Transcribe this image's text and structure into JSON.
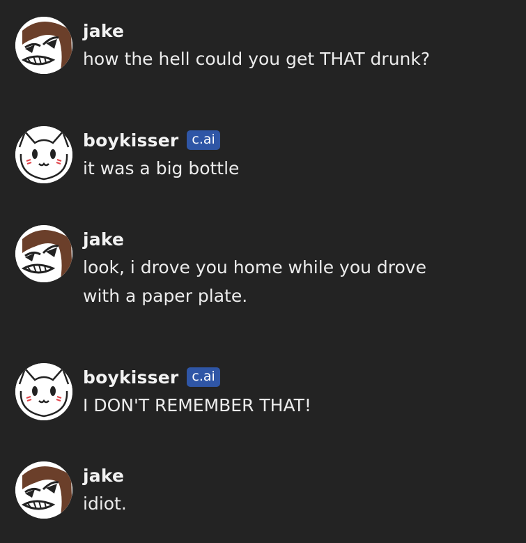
{
  "messages": [
    {
      "author": "jake",
      "avatar_icon": "jake-avatar-icon",
      "badge": "",
      "text": "how the hell could you get THAT drunk?"
    },
    {
      "author": "boykisser",
      "avatar_icon": "boykisser-avatar-icon",
      "badge": "c.ai",
      "text": "it was a big bottle"
    },
    {
      "author": "jake",
      "avatar_icon": "jake-avatar-icon",
      "badge": "",
      "text": "look, i drove you home while you drove with a paper plate."
    },
    {
      "author": "boykisser",
      "avatar_icon": "boykisser-avatar-icon",
      "badge": "c.ai",
      "text": "I DON'T REMEMBER THAT!"
    },
    {
      "author": "jake",
      "avatar_icon": "jake-avatar-icon",
      "badge": "",
      "text": "idiot."
    }
  ],
  "colors": {
    "background": "#232323",
    "text": "#ececec",
    "badge_background": "#2f56a6",
    "jake_hair": "#6b3f2a"
  }
}
